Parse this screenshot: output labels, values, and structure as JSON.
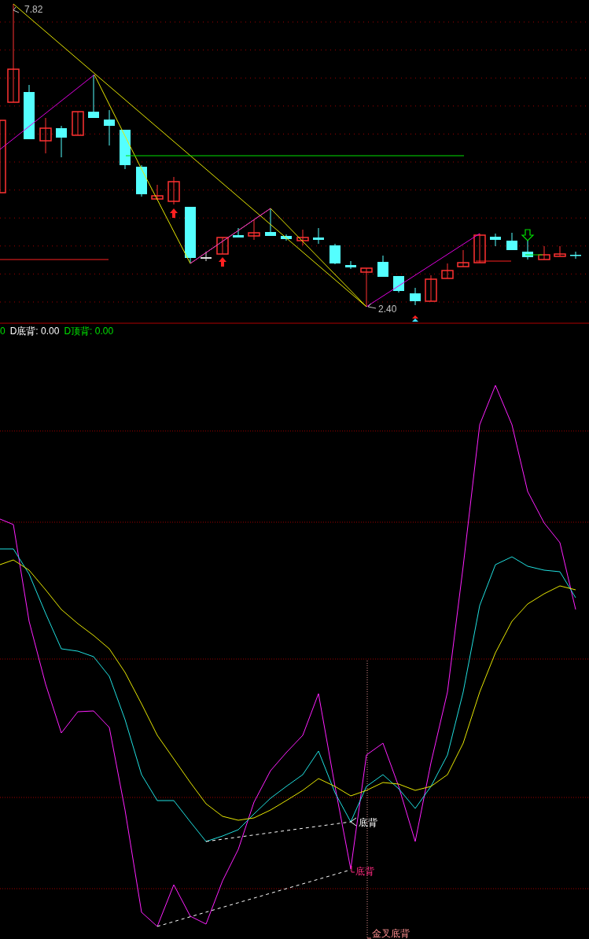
{
  "price_panel": {
    "high_label": "7.82",
    "low_label": "2.40"
  },
  "legend": [
    {
      "text": "0",
      "color": "#00e000"
    },
    {
      "text": "D底背: 0.00",
      "color": "#ffffff"
    },
    {
      "text": "D顶背: 0.00",
      "color": "#00e000"
    }
  ],
  "indicator_panel": {
    "signals": [
      {
        "kind": "k-divergence",
        "label": "底背"
      },
      {
        "kind": "j-divergence",
        "label": "底背"
      },
      {
        "kind": "golden-cross",
        "label": "金叉底背"
      }
    ]
  }
}
